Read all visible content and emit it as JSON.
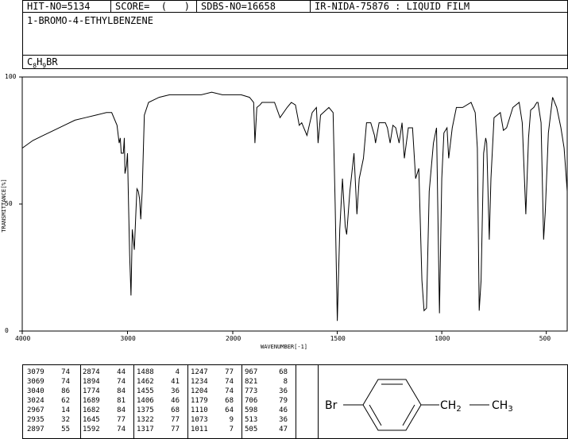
{
  "header": {
    "hit_no": "HIT-NO=5134",
    "score": "SCORE=  (   )",
    "sdbs_no": "SDBS-NO=16658",
    "ir_nida": "IR-NIDA-75876 : LIQUID FILM",
    "compound_name": "1-BROMO-4-ETHYLBENZENE",
    "formula": {
      "c": "C",
      "c_n": "8",
      "h": "H",
      "h_n": "9",
      "rest": "BR"
    }
  },
  "chart_data": {
    "type": "line",
    "xlabel": "WAVENUMBER[-1]",
    "ylabel": "TRANSMITTANCE[%]",
    "xlim": [
      4000,
      400
    ],
    "ylim": [
      0,
      100
    ],
    "x_ticks": [
      "4000",
      "3000",
      "2000",
      "1500",
      "1000",
      "500"
    ],
    "y_ticks": [
      "100",
      "50",
      "0"
    ],
    "x": [
      4000,
      3900,
      3800,
      3700,
      3600,
      3500,
      3400,
      3300,
      3200,
      3150,
      3100,
      3079,
      3069,
      3060,
      3040,
      3030,
      3024,
      3010,
      3000,
      2990,
      2980,
      2967,
      2955,
      2935,
      2920,
      2910,
      2897,
      2885,
      2874,
      2860,
      2840,
      2800,
      2700,
      2600,
      2500,
      2400,
      2300,
      2200,
      2100,
      2000,
      1960,
      1920,
      1900,
      1894,
      1885,
      1870,
      1860,
      1800,
      1774,
      1740,
      1720,
      1700,
      1682,
      1670,
      1645,
      1620,
      1600,
      1592,
      1580,
      1540,
      1520,
      1510,
      1500,
      1488,
      1475,
      1462,
      1455,
      1440,
      1420,
      1406,
      1395,
      1375,
      1360,
      1340,
      1322,
      1317,
      1300,
      1270,
      1260,
      1247,
      1234,
      1220,
      1204,
      1190,
      1179,
      1160,
      1140,
      1125,
      1110,
      1095,
      1085,
      1073,
      1060,
      1040,
      1025,
      1011,
      1000,
      990,
      975,
      967,
      950,
      930,
      900,
      860,
      840,
      830,
      821,
      812,
      800,
      790,
      785,
      773,
      765,
      750,
      720,
      705,
      690,
      660,
      630,
      615,
      598,
      585,
      575,
      560,
      545,
      540,
      525,
      513,
      505,
      490,
      470,
      450,
      430,
      415,
      400
    ],
    "y": [
      72,
      75,
      77,
      79,
      81,
      83,
      84,
      85,
      86,
      86,
      81,
      74,
      76,
      70,
      70,
      76,
      62,
      65,
      70,
      50,
      30,
      14,
      40,
      32,
      47,
      56,
      55,
      52,
      44,
      55,
      85,
      90,
      92,
      93,
      93,
      93,
      93,
      94,
      93,
      93,
      93,
      92,
      90,
      74,
      88,
      89,
      90,
      90,
      84,
      88,
      90,
      89,
      81,
      82,
      77,
      86,
      88,
      74,
      85,
      88,
      86,
      50,
      4,
      40,
      60,
      41,
      38,
      55,
      70,
      46,
      60,
      68,
      82,
      82,
      77,
      74,
      82,
      82,
      80,
      74,
      81,
      80,
      74,
      82,
      68,
      80,
      80,
      60,
      64,
      20,
      8,
      9,
      55,
      74,
      80,
      7,
      60,
      78,
      80,
      68,
      80,
      88,
      88,
      90,
      86,
      72,
      8,
      20,
      70,
      76,
      74,
      36,
      60,
      84,
      86,
      79,
      80,
      88,
      90,
      82,
      46,
      76,
      87,
      88,
      90,
      90,
      82,
      36,
      47,
      78,
      92,
      88,
      80,
      72,
      55
    ]
  },
  "peaks": [
    [
      [
        "3079",
        "74"
      ],
      [
        "3069",
        "74"
      ],
      [
        "3040",
        "86"
      ],
      [
        "3024",
        "62"
      ],
      [
        "2967",
        "14"
      ],
      [
        "2935",
        "32"
      ],
      [
        "2897",
        "55"
      ]
    ],
    [
      [
        "2874",
        "44"
      ],
      [
        "1894",
        "74"
      ],
      [
        "1774",
        "84"
      ],
      [
        "1689",
        "81"
      ],
      [
        "1682",
        "84"
      ],
      [
        "1645",
        "77"
      ],
      [
        "1592",
        "74"
      ]
    ],
    [
      [
        "1488",
        "4"
      ],
      [
        "1462",
        "41"
      ],
      [
        "1455",
        "36"
      ],
      [
        "1406",
        "46"
      ],
      [
        "1375",
        "68"
      ],
      [
        "1322",
        "77"
      ],
      [
        "1317",
        "77"
      ]
    ],
    [
      [
        "1247",
        "77"
      ],
      [
        "1234",
        "74"
      ],
      [
        "1204",
        "74"
      ],
      [
        "1179",
        "68"
      ],
      [
        "1110",
        "64"
      ],
      [
        "1073",
        "9"
      ],
      [
        "1011",
        "7"
      ]
    ],
    [
      [
        "967",
        "68"
      ],
      [
        "821",
        "8"
      ],
      [
        "773",
        "36"
      ],
      [
        "706",
        "79"
      ],
      [
        "598",
        "46"
      ],
      [
        "513",
        "36"
      ],
      [
        "505",
        "47"
      ]
    ]
  ],
  "structure": {
    "substituent_left": "Br",
    "chain_1": "CH",
    "chain_1_sub": "2",
    "chain_2": "CH",
    "chain_2_sub": "3"
  }
}
